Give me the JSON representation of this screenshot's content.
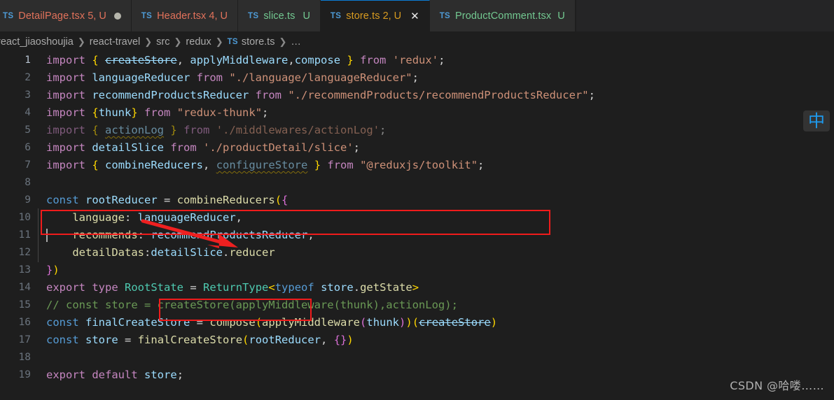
{
  "editor": {
    "name": "vscode-editor",
    "theme_colors": {
      "background": "#1e1e1e",
      "tabbar_background": "#252526",
      "active_tab_background": "#1e1e1e",
      "active_tab_border": "#0b7cd4",
      "line_number": "#6a737d",
      "annotation_red": "#f01b1b",
      "ime_blue": "#1e9bf0",
      "squiggle_warning": "#cca700"
    }
  },
  "tabs": [
    {
      "icon": "ts-file-icon",
      "label": "DetailPage.tsx",
      "suffix": "5, U",
      "modified": true,
      "active": false,
      "close_label": ""
    },
    {
      "icon": "ts-file-icon",
      "label": "Header.tsx",
      "suffix": "4, U",
      "modified": false,
      "active": false,
      "close_label": ""
    },
    {
      "icon": "ts-file-icon",
      "label": "slice.ts",
      "suffix": "U",
      "modified": false,
      "active": false,
      "close_label": ""
    },
    {
      "icon": "ts-file-icon",
      "label": "store.ts",
      "suffix": "2, U",
      "modified": false,
      "active": true,
      "close_label": "✕"
    },
    {
      "icon": "ts-file-icon",
      "label": "ProductComment.tsx",
      "suffix": "U",
      "modified": false,
      "active": false,
      "close_label": ""
    }
  ],
  "ts_icon_text": "TS",
  "breadcrumb": {
    "separator": "❯",
    "items": [
      {
        "label": "react_jiaoshoujia",
        "icon": null
      },
      {
        "label": "react-travel",
        "icon": null
      },
      {
        "label": "src",
        "icon": null
      },
      {
        "label": "redux",
        "icon": null
      },
      {
        "label": "store.ts",
        "icon": "ts-file-icon"
      },
      {
        "label": "…",
        "icon": null
      }
    ]
  },
  "code": {
    "language": "typescript",
    "file": "store.ts",
    "cursor_line": 8,
    "lines": [
      {
        "n": "1",
        "text": "import { createStore, applyMiddleware,compose } from 'redux';"
      },
      {
        "n": "2",
        "text": "import languageReducer from \"./language/languageReducer\";"
      },
      {
        "n": "3",
        "text": "import recommendProductsReducer from \"./recommendProducts/recommendProductsReducer\";"
      },
      {
        "n": "4",
        "text": "import {thunk} from \"redux-thunk\";"
      },
      {
        "n": "5",
        "text": "import { actionLog } from './middlewares/actionLog';"
      },
      {
        "n": "6",
        "text": "import detailSlice from './productDetail/slice';"
      },
      {
        "n": "7",
        "text": "import { combineReducers, configureStore } from \"@reduxjs/toolkit\";"
      },
      {
        "n": "8",
        "text": ""
      },
      {
        "n": "9",
        "text": "const rootReducer = combineReducers({"
      },
      {
        "n": "10",
        "text": "    language: languageReducer,"
      },
      {
        "n": "11",
        "text": "    recommends: recommendProductsReducer,"
      },
      {
        "n": "12",
        "text": "    detailDatas:detailSlice.reducer"
      },
      {
        "n": "13",
        "text": "})"
      },
      {
        "n": "14",
        "text": "export type RootState = ReturnType<typeof store.getState>"
      },
      {
        "n": "15",
        "text": "// const store = createStore(applyMiddleware(thunk),actionLog);"
      },
      {
        "n": "16",
        "text": "const finalCreateStore = compose(applyMiddleware(thunk))(createStore)"
      },
      {
        "n": "17",
        "text": "const store = finalCreateStore(rootReducer, {})"
      },
      {
        "n": "18",
        "text": ""
      },
      {
        "n": "19",
        "text": "export default store;"
      }
    ]
  },
  "annotations": {
    "red_box_import_line": "import { combineReducers, configureStore } from \"@reduxjs/toolkit\";",
    "red_box_reducer": "detailSlice.reducer",
    "arrow": "red-arrow-pointing-down-right"
  },
  "ime_indicator": {
    "glyph": "中",
    "name": "chinese-input-mode"
  },
  "watermark": {
    "text": "CSDN @哈喽……"
  }
}
